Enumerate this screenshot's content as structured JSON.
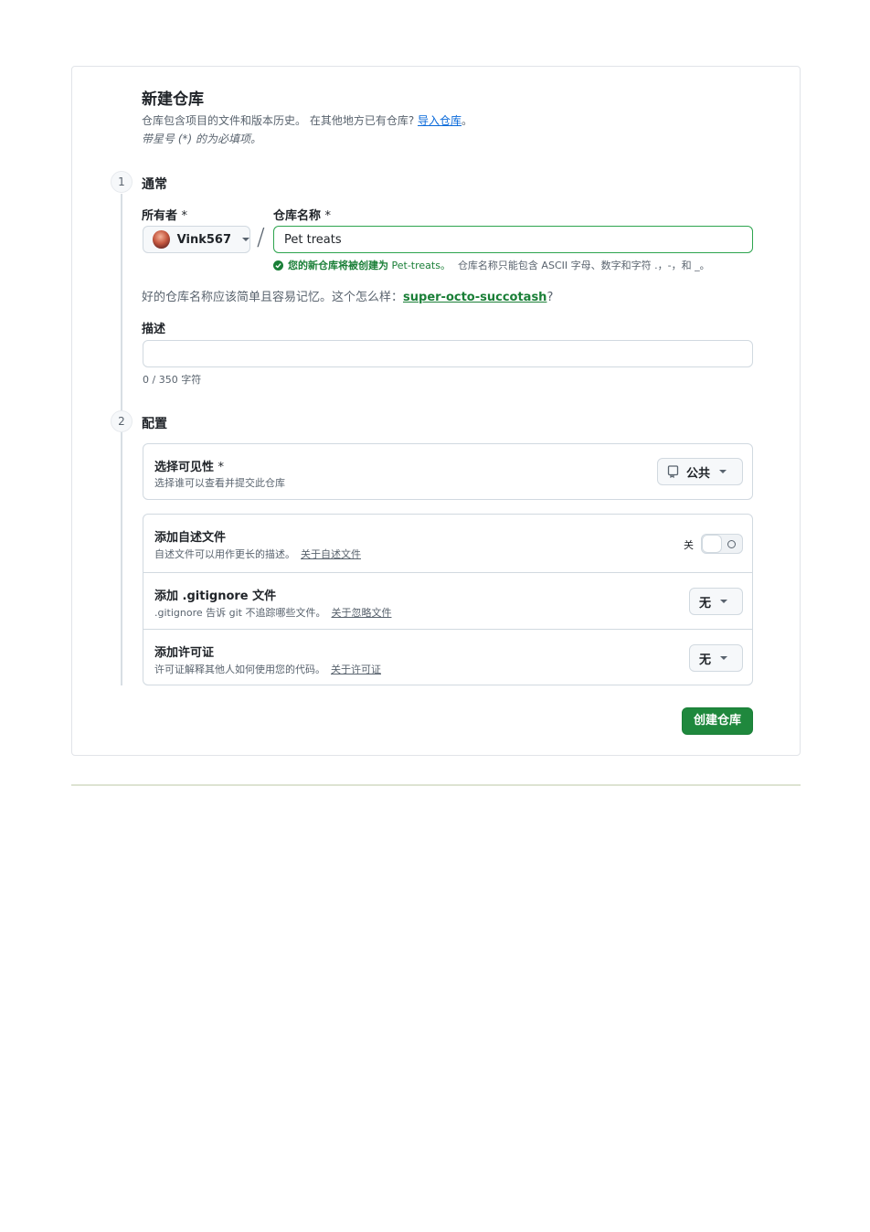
{
  "header": {
    "title": "新建仓库",
    "subtitle": "仓库包含项目的文件和版本历史。 在其他地方已有仓库?",
    "import_link": "导入仓库",
    "subtitle_end": "。",
    "required_note": "带星号 (*) 的为必填项。"
  },
  "step1": {
    "number": "1",
    "title": "通常",
    "owner_label": "所有者",
    "owner_required": "*",
    "owner_value": "Vink567",
    "separator": "/",
    "repo_label": "仓库名称",
    "repo_required": "*",
    "repo_value": "Pet treats",
    "validation_strong": "您的新仓库将被创建为",
    "validation_name": "Pet-treats",
    "validation_suffix": "。",
    "validation_rest": "仓库名称只能包含 ASCII 字母、数字和字符 .，-，和 _。",
    "suggestion_text": "好的仓库名称应该简单且容易记忆。这个怎么样：",
    "suggestion_link": "super-octo-succotash",
    "suggestion_end": "?",
    "description_label": "描述",
    "description_value": "",
    "char_count": "0 / 350 字符"
  },
  "step2": {
    "number": "2",
    "title": "配置",
    "visibility": {
      "title": "选择可见性",
      "required": "*",
      "desc": "选择谁可以查看并提交此仓库",
      "button": "公共",
      "icon": "repo-icon"
    },
    "readme": {
      "title": "添加自述文件",
      "desc": "自述文件可以用作更长的描述。",
      "link": "关于自述文件",
      "toggle_label": "关",
      "toggle_on": false
    },
    "gitignore": {
      "title": "添加 .gitignore 文件",
      "desc": ".gitignore 告诉 git 不追踪哪些文件。",
      "link": "关于忽略文件",
      "button": "无"
    },
    "license": {
      "title": "添加许可证",
      "desc": "许可证解释其他人如何使用您的代码。",
      "link": "关于许可证",
      "button": "无"
    }
  },
  "footer": {
    "create_button": "创建仓库"
  },
  "colors": {
    "primary_green": "#1f883d",
    "link_blue": "#0969da",
    "success_green": "#1a7f37"
  }
}
